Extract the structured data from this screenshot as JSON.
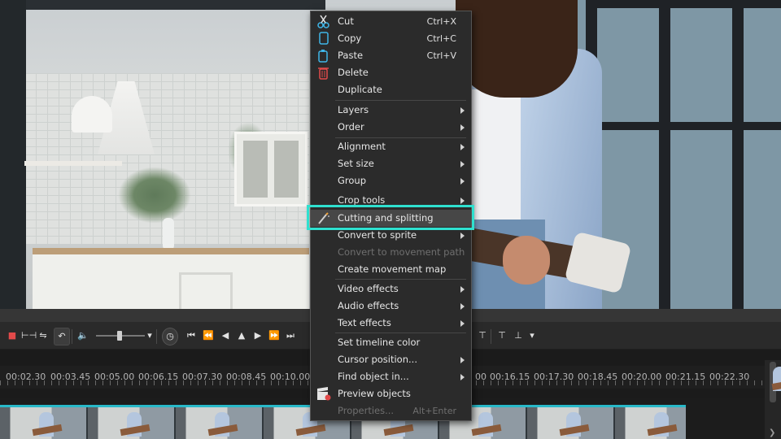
{
  "menu": {
    "items": [
      {
        "label": "Cut",
        "shortcut": "Ctrl+X",
        "icon": "scissors-icon"
      },
      {
        "label": "Copy",
        "shortcut": "Ctrl+C",
        "icon": "copy-icon"
      },
      {
        "label": "Paste",
        "shortcut": "Ctrl+V",
        "icon": "paste-icon"
      },
      {
        "label": "Delete",
        "icon": "trash-icon"
      },
      {
        "label": "Duplicate"
      },
      {
        "label": "Layers"
      },
      {
        "label": "Order"
      },
      {
        "label": "Alignment"
      },
      {
        "label": "Set size"
      },
      {
        "label": "Group"
      },
      {
        "label": "Crop tools"
      },
      {
        "label": "Cutting and splitting",
        "icon": "magic-wand-icon"
      },
      {
        "label": "Convert to sprite"
      },
      {
        "label": "Convert to movement path"
      },
      {
        "label": "Create movement map"
      },
      {
        "label": "Video effects"
      },
      {
        "label": "Audio effects"
      },
      {
        "label": "Text effects"
      },
      {
        "label": "Set timeline color"
      },
      {
        "label": "Cursor position..."
      },
      {
        "label": "Find object in..."
      },
      {
        "label": "Preview objects",
        "icon": "clapperboard-icon"
      },
      {
        "label": "Properties...",
        "shortcut": "Alt+Enter"
      }
    ]
  },
  "timeline": {
    "ticks": [
      "00:02.30",
      "00:03.45",
      "00:05.00",
      "00:06.15",
      "00:07.30",
      "00:08.45",
      "00:10.00",
      "00",
      "00:16.15",
      "00:17.30",
      "00:18.45",
      "00:20.00",
      "00:21.15",
      "00:22.30"
    ]
  },
  "colors": {
    "highlight_box": "#2fe0cf",
    "clip_border": "#29b9c9",
    "record": "#e24a4a"
  }
}
